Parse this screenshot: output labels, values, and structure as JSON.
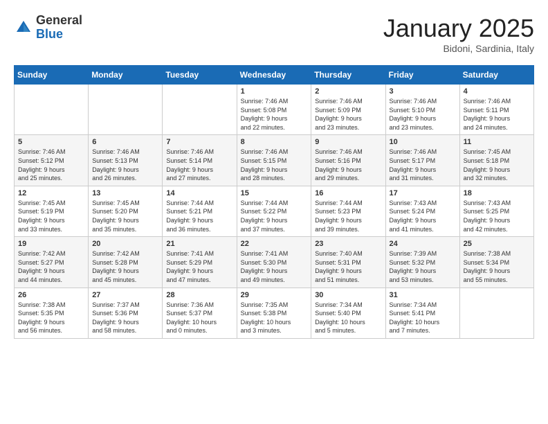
{
  "header": {
    "logo_general": "General",
    "logo_blue": "Blue",
    "month": "January 2025",
    "location": "Bidoni, Sardinia, Italy"
  },
  "weekdays": [
    "Sunday",
    "Monday",
    "Tuesday",
    "Wednesday",
    "Thursday",
    "Friday",
    "Saturday"
  ],
  "weeks": [
    [
      {
        "day": "",
        "info": ""
      },
      {
        "day": "",
        "info": ""
      },
      {
        "day": "",
        "info": ""
      },
      {
        "day": "1",
        "info": "Sunrise: 7:46 AM\nSunset: 5:08 PM\nDaylight: 9 hours\nand 22 minutes."
      },
      {
        "day": "2",
        "info": "Sunrise: 7:46 AM\nSunset: 5:09 PM\nDaylight: 9 hours\nand 23 minutes."
      },
      {
        "day": "3",
        "info": "Sunrise: 7:46 AM\nSunset: 5:10 PM\nDaylight: 9 hours\nand 23 minutes."
      },
      {
        "day": "4",
        "info": "Sunrise: 7:46 AM\nSunset: 5:11 PM\nDaylight: 9 hours\nand 24 minutes."
      }
    ],
    [
      {
        "day": "5",
        "info": "Sunrise: 7:46 AM\nSunset: 5:12 PM\nDaylight: 9 hours\nand 25 minutes."
      },
      {
        "day": "6",
        "info": "Sunrise: 7:46 AM\nSunset: 5:13 PM\nDaylight: 9 hours\nand 26 minutes."
      },
      {
        "day": "7",
        "info": "Sunrise: 7:46 AM\nSunset: 5:14 PM\nDaylight: 9 hours\nand 27 minutes."
      },
      {
        "day": "8",
        "info": "Sunrise: 7:46 AM\nSunset: 5:15 PM\nDaylight: 9 hours\nand 28 minutes."
      },
      {
        "day": "9",
        "info": "Sunrise: 7:46 AM\nSunset: 5:16 PM\nDaylight: 9 hours\nand 29 minutes."
      },
      {
        "day": "10",
        "info": "Sunrise: 7:46 AM\nSunset: 5:17 PM\nDaylight: 9 hours\nand 31 minutes."
      },
      {
        "day": "11",
        "info": "Sunrise: 7:45 AM\nSunset: 5:18 PM\nDaylight: 9 hours\nand 32 minutes."
      }
    ],
    [
      {
        "day": "12",
        "info": "Sunrise: 7:45 AM\nSunset: 5:19 PM\nDaylight: 9 hours\nand 33 minutes."
      },
      {
        "day": "13",
        "info": "Sunrise: 7:45 AM\nSunset: 5:20 PM\nDaylight: 9 hours\nand 35 minutes."
      },
      {
        "day": "14",
        "info": "Sunrise: 7:44 AM\nSunset: 5:21 PM\nDaylight: 9 hours\nand 36 minutes."
      },
      {
        "day": "15",
        "info": "Sunrise: 7:44 AM\nSunset: 5:22 PM\nDaylight: 9 hours\nand 37 minutes."
      },
      {
        "day": "16",
        "info": "Sunrise: 7:44 AM\nSunset: 5:23 PM\nDaylight: 9 hours\nand 39 minutes."
      },
      {
        "day": "17",
        "info": "Sunrise: 7:43 AM\nSunset: 5:24 PM\nDaylight: 9 hours\nand 41 minutes."
      },
      {
        "day": "18",
        "info": "Sunrise: 7:43 AM\nSunset: 5:25 PM\nDaylight: 9 hours\nand 42 minutes."
      }
    ],
    [
      {
        "day": "19",
        "info": "Sunrise: 7:42 AM\nSunset: 5:27 PM\nDaylight: 9 hours\nand 44 minutes."
      },
      {
        "day": "20",
        "info": "Sunrise: 7:42 AM\nSunset: 5:28 PM\nDaylight: 9 hours\nand 45 minutes."
      },
      {
        "day": "21",
        "info": "Sunrise: 7:41 AM\nSunset: 5:29 PM\nDaylight: 9 hours\nand 47 minutes."
      },
      {
        "day": "22",
        "info": "Sunrise: 7:41 AM\nSunset: 5:30 PM\nDaylight: 9 hours\nand 49 minutes."
      },
      {
        "day": "23",
        "info": "Sunrise: 7:40 AM\nSunset: 5:31 PM\nDaylight: 9 hours\nand 51 minutes."
      },
      {
        "day": "24",
        "info": "Sunrise: 7:39 AM\nSunset: 5:32 PM\nDaylight: 9 hours\nand 53 minutes."
      },
      {
        "day": "25",
        "info": "Sunrise: 7:38 AM\nSunset: 5:34 PM\nDaylight: 9 hours\nand 55 minutes."
      }
    ],
    [
      {
        "day": "26",
        "info": "Sunrise: 7:38 AM\nSunset: 5:35 PM\nDaylight: 9 hours\nand 56 minutes."
      },
      {
        "day": "27",
        "info": "Sunrise: 7:37 AM\nSunset: 5:36 PM\nDaylight: 9 hours\nand 58 minutes."
      },
      {
        "day": "28",
        "info": "Sunrise: 7:36 AM\nSunset: 5:37 PM\nDaylight: 10 hours\nand 0 minutes."
      },
      {
        "day": "29",
        "info": "Sunrise: 7:35 AM\nSunset: 5:38 PM\nDaylight: 10 hours\nand 3 minutes."
      },
      {
        "day": "30",
        "info": "Sunrise: 7:34 AM\nSunset: 5:40 PM\nDaylight: 10 hours\nand 5 minutes."
      },
      {
        "day": "31",
        "info": "Sunrise: 7:34 AM\nSunset: 5:41 PM\nDaylight: 10 hours\nand 7 minutes."
      },
      {
        "day": "",
        "info": ""
      }
    ]
  ]
}
